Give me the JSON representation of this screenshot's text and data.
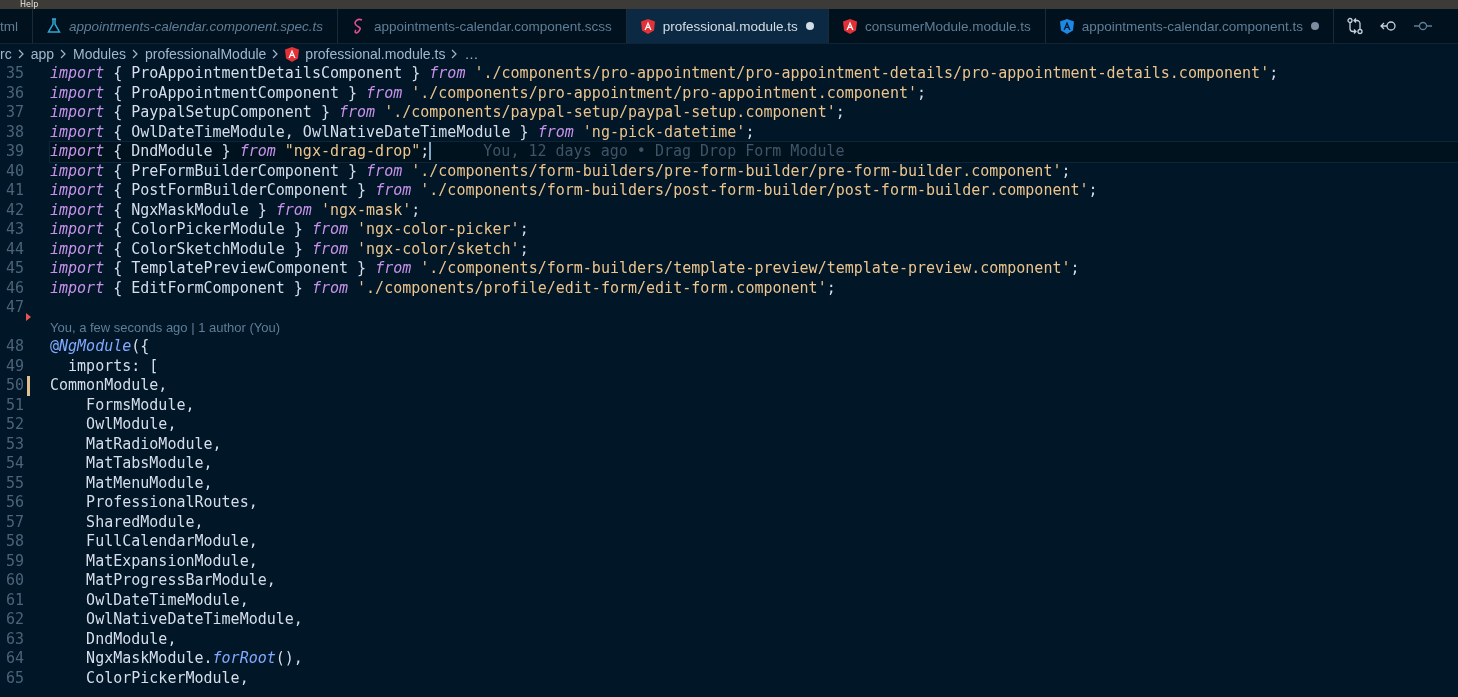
{
  "menu_bar": {
    "items": [
      "Help"
    ]
  },
  "tabs": [
    {
      "label": "tml",
      "kind": "plain",
      "italic": false,
      "selected": false
    },
    {
      "label": "appointments-calendar.component.spec.ts",
      "kind": "test",
      "italic": true,
      "selected": false
    },
    {
      "label": "appointments-calendar.component.scss",
      "kind": "style",
      "italic": false,
      "selected": false
    },
    {
      "label": "professional.module.ts",
      "kind": "module",
      "italic": false,
      "selected": true,
      "dirty": true
    },
    {
      "label": "consumerModule.module.ts",
      "kind": "module",
      "italic": false,
      "selected": false
    },
    {
      "label": "appointments-calendar.component.ts",
      "kind": "component",
      "italic": false,
      "selected": false,
      "dirty": true
    }
  ],
  "breadcrumb": [
    {
      "label": "rc",
      "kind": "folder"
    },
    {
      "label": "app",
      "kind": "folder"
    },
    {
      "label": "Modules",
      "kind": "folder"
    },
    {
      "label": "professionalModule",
      "kind": "folder"
    },
    {
      "label": "professional.module.ts",
      "kind": "file"
    },
    {
      "label": "…",
      "kind": "more"
    }
  ],
  "editor": {
    "lines": [
      {
        "number": "35",
        "tokens": [
          {
            "kind": "kw",
            "text": "import"
          },
          {
            "kind": "plain",
            "text": " { ProAppointmentDetailsComponent } "
          },
          {
            "kind": "kw",
            "text": "from"
          },
          {
            "kind": "str",
            "text": " './components/pro-appointment/pro-appointment-details/pro-appointment-details.component'"
          },
          {
            "kind": "plain",
            "text": ";"
          }
        ]
      },
      {
        "number": "36",
        "tokens": [
          {
            "kind": "kw",
            "text": "import"
          },
          {
            "kind": "plain",
            "text": " { ProAppointmentComponent } "
          },
          {
            "kind": "kw",
            "text": "from"
          },
          {
            "kind": "str",
            "text": " './components/pro-appointment/pro-appointment.component'"
          },
          {
            "kind": "plain",
            "text": ";"
          }
        ]
      },
      {
        "number": "37",
        "tokens": [
          {
            "kind": "kw",
            "text": "import"
          },
          {
            "kind": "plain",
            "text": " { PaypalSetupComponent } "
          },
          {
            "kind": "kw",
            "text": "from"
          },
          {
            "kind": "str",
            "text": " './components/paypal-setup/paypal-setup.component'"
          },
          {
            "kind": "plain",
            "text": ";"
          }
        ]
      },
      {
        "number": "38",
        "tokens": [
          {
            "kind": "kw",
            "text": "import"
          },
          {
            "kind": "plain",
            "text": " { OwlDateTimeModule, OwlNativeDateTimeModule } "
          },
          {
            "kind": "kw",
            "text": "from"
          },
          {
            "kind": "str",
            "text": " 'ng-pick-datetime'"
          },
          {
            "kind": "plain",
            "text": ";"
          }
        ]
      },
      {
        "number": "39",
        "current": true,
        "blame": "You, 12 days ago • Drag Drop Form Module",
        "tokens": [
          {
            "kind": "kw",
            "text": "import"
          },
          {
            "kind": "plain",
            "text": " { DndModule } "
          },
          {
            "kind": "kw",
            "text": "from"
          },
          {
            "kind": "str",
            "text": " \"ngx-drag-drop\""
          },
          {
            "kind": "plain",
            "text": ";"
          }
        ]
      },
      {
        "number": "40",
        "tokens": [
          {
            "kind": "kw",
            "text": "import"
          },
          {
            "kind": "plain",
            "text": " { PreFormBuilderComponent } "
          },
          {
            "kind": "kw",
            "text": "from"
          },
          {
            "kind": "str",
            "text": " './components/form-builders/pre-form-builder/pre-form-builder.component'"
          },
          {
            "kind": "plain",
            "text": ";"
          }
        ]
      },
      {
        "number": "41",
        "tokens": [
          {
            "kind": "kw",
            "text": "import"
          },
          {
            "kind": "plain",
            "text": " { PostFormBuilderComponent } "
          },
          {
            "kind": "kw",
            "text": "from"
          },
          {
            "kind": "str",
            "text": " './components/form-builders/post-form-builder/post-form-builder.component'"
          },
          {
            "kind": "plain",
            "text": ";"
          }
        ]
      },
      {
        "number": "42",
        "tokens": [
          {
            "kind": "kw",
            "text": "import"
          },
          {
            "kind": "plain",
            "text": " { NgxMaskModule } "
          },
          {
            "kind": "kw",
            "text": "from"
          },
          {
            "kind": "str",
            "text": " 'ngx-mask'"
          },
          {
            "kind": "plain",
            "text": ";"
          }
        ]
      },
      {
        "number": "43",
        "tokens": [
          {
            "kind": "kw",
            "text": "import"
          },
          {
            "kind": "plain",
            "text": " { ColorPickerModule } "
          },
          {
            "kind": "kw",
            "text": "from"
          },
          {
            "kind": "str",
            "text": " 'ngx-color-picker'"
          },
          {
            "kind": "plain",
            "text": ";"
          }
        ]
      },
      {
        "number": "44",
        "tokens": [
          {
            "kind": "kw",
            "text": "import"
          },
          {
            "kind": "plain",
            "text": " { ColorSketchModule } "
          },
          {
            "kind": "kw",
            "text": "from"
          },
          {
            "kind": "str",
            "text": " 'ngx-color/sketch'"
          },
          {
            "kind": "plain",
            "text": ";"
          }
        ]
      },
      {
        "number": "45",
        "tokens": [
          {
            "kind": "kw",
            "text": "import"
          },
          {
            "kind": "plain",
            "text": " { TemplatePreviewComponent } "
          },
          {
            "kind": "kw",
            "text": "from"
          },
          {
            "kind": "str",
            "text": " './components/form-builders/template-preview/template-preview.component'"
          },
          {
            "kind": "plain",
            "text": ";"
          }
        ]
      },
      {
        "number": "46",
        "tokens": [
          {
            "kind": "kw",
            "text": "import"
          },
          {
            "kind": "plain",
            "text": " { EditFormComponent } "
          },
          {
            "kind": "kw",
            "text": "from"
          },
          {
            "kind": "str",
            "text": " './components/profile/edit-form/edit-form.component'"
          },
          {
            "kind": "plain",
            "text": ";"
          }
        ]
      },
      {
        "number": "47",
        "git_deleted": true
      },
      {
        "kind": "codelens",
        "text": "You, a few seconds ago | 1 author (You)"
      },
      {
        "number": "48",
        "tokens": [
          {
            "kind": "deco",
            "text": "@"
          },
          {
            "kind": "fn",
            "text": "NgModule"
          },
          {
            "kind": "plain",
            "text": "({"
          }
        ]
      },
      {
        "number": "49",
        "tokens": [
          {
            "kind": "plain",
            "text": "  imports: ["
          }
        ]
      },
      {
        "number": "50",
        "git_modified": true,
        "tokens": [
          {
            "kind": "plain",
            "text": "CommonModule,"
          }
        ]
      },
      {
        "number": "51",
        "tokens": [
          {
            "kind": "plain",
            "text": "    FormsModule,"
          }
        ]
      },
      {
        "number": "52",
        "tokens": [
          {
            "kind": "plain",
            "text": "    OwlModule,"
          }
        ]
      },
      {
        "number": "53",
        "tokens": [
          {
            "kind": "plain",
            "text": "    MatRadioModule,"
          }
        ]
      },
      {
        "number": "54",
        "tokens": [
          {
            "kind": "plain",
            "text": "    MatTabsModule,"
          }
        ]
      },
      {
        "number": "55",
        "tokens": [
          {
            "kind": "plain",
            "text": "    MatMenuModule,"
          }
        ]
      },
      {
        "number": "56",
        "tokens": [
          {
            "kind": "plain",
            "text": "    ProfessionalRoutes,"
          }
        ]
      },
      {
        "number": "57",
        "tokens": [
          {
            "kind": "plain",
            "text": "    SharedModule,"
          }
        ]
      },
      {
        "number": "58",
        "tokens": [
          {
            "kind": "plain",
            "text": "    FullCalendarModule,"
          }
        ]
      },
      {
        "number": "59",
        "tokens": [
          {
            "kind": "plain",
            "text": "    MatExpansionModule,"
          }
        ]
      },
      {
        "number": "60",
        "tokens": [
          {
            "kind": "plain",
            "text": "    MatProgressBarModule,"
          }
        ]
      },
      {
        "number": "61",
        "tokens": [
          {
            "kind": "plain",
            "text": "    OwlDateTimeModule,"
          }
        ]
      },
      {
        "number": "62",
        "tokens": [
          {
            "kind": "plain",
            "text": "    OwlNativeDateTimeModule,"
          }
        ]
      },
      {
        "number": "63",
        "tokens": [
          {
            "kind": "plain",
            "text": "    DndModule,"
          }
        ]
      },
      {
        "number": "64",
        "tokens": [
          {
            "kind": "plain",
            "text": "    NgxMaskModule."
          },
          {
            "kind": "fn",
            "text": "forRoot"
          },
          {
            "kind": "plain",
            "text": "(),"
          }
        ]
      },
      {
        "number": "65",
        "tokens": [
          {
            "kind": "plain",
            "text": "    ColorPickerModule,"
          }
        ]
      }
    ]
  }
}
